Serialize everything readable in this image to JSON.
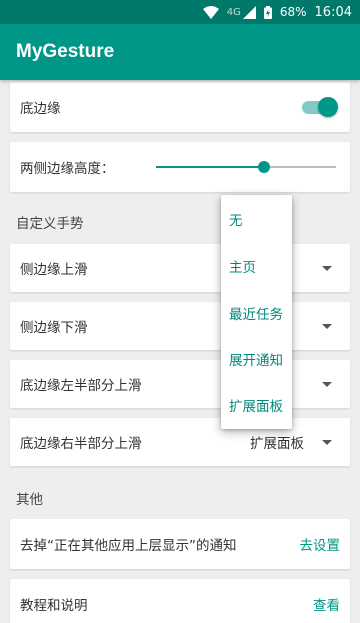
{
  "status_bar": {
    "network": "4G",
    "battery": "68%",
    "time": "16:04",
    "icons": [
      "wifi-icon",
      "signal-icon",
      "battery-icon"
    ]
  },
  "app_bar": {
    "title": "MyGesture"
  },
  "colors": {
    "primary": "#009688",
    "primary_dark": "#00796B",
    "background": "#EEEEEE"
  },
  "settings": {
    "bottom_edge": {
      "label": "底边缘",
      "enabled": true
    },
    "side_height": {
      "label": "两侧边缘高度：",
      "value_fraction": 0.6
    }
  },
  "custom_gestures": {
    "header": "自定义手势",
    "items": [
      {
        "label": "侧边缘上滑",
        "value": ""
      },
      {
        "label": "侧边缘下滑",
        "value": ""
      },
      {
        "label": "底边缘左半部分上滑",
        "value": ""
      },
      {
        "label": "底边缘右半部分上滑",
        "value": "扩展面板"
      }
    ]
  },
  "popup_menu": {
    "options": [
      "无",
      "主页",
      "最近任务",
      "展开通知",
      "扩展面板"
    ]
  },
  "other": {
    "header": "其他",
    "overlay_notice": {
      "label": "去掉“正在其他应用上层显示”的通知",
      "action": "去设置"
    },
    "tutorial": {
      "label": "教程和说明",
      "action": "查看"
    }
  }
}
